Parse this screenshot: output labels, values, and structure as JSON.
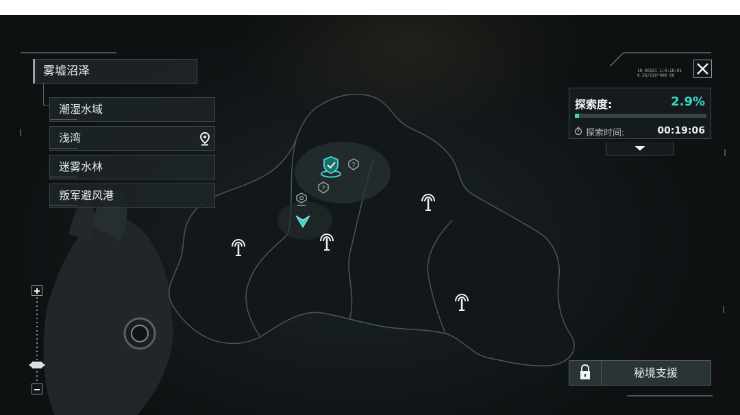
{
  "region": {
    "main": "雾墟沼泽",
    "subregions": [
      {
        "label": "潮湿水域",
        "pinned": false
      },
      {
        "label": "浅湾",
        "pinned": true
      },
      {
        "label": "迷雾水林",
        "pinned": false
      },
      {
        "label": "叛军避风港",
        "pinned": false
      }
    ]
  },
  "hud": {
    "code_line1": "18-00101 1:0:18:01",
    "code_line2": "0.26/210*000 00"
  },
  "exploration": {
    "label": "探索度:",
    "percent_text": "2.9%",
    "percent_value": 2.9,
    "time_label": "探索时间:",
    "time_value": "00:19:06"
  },
  "support": {
    "label": "秘境支援",
    "locked": true
  },
  "icons": {
    "close": "close-icon",
    "pin": "map-pin-icon",
    "timer": "timer-icon",
    "expand": "chevron-down-icon",
    "lock": "lock-icon",
    "tower": "signal-tower-icon",
    "player": "player-arrow-icon",
    "shield_marker": "shield-marker-icon",
    "unknown": "unknown-marker-icon",
    "waypoint": "waypoint-icon"
  },
  "colors": {
    "accent": "#3fd6c8",
    "panel_bg": "#161c1e",
    "text": "#e8eeee"
  }
}
